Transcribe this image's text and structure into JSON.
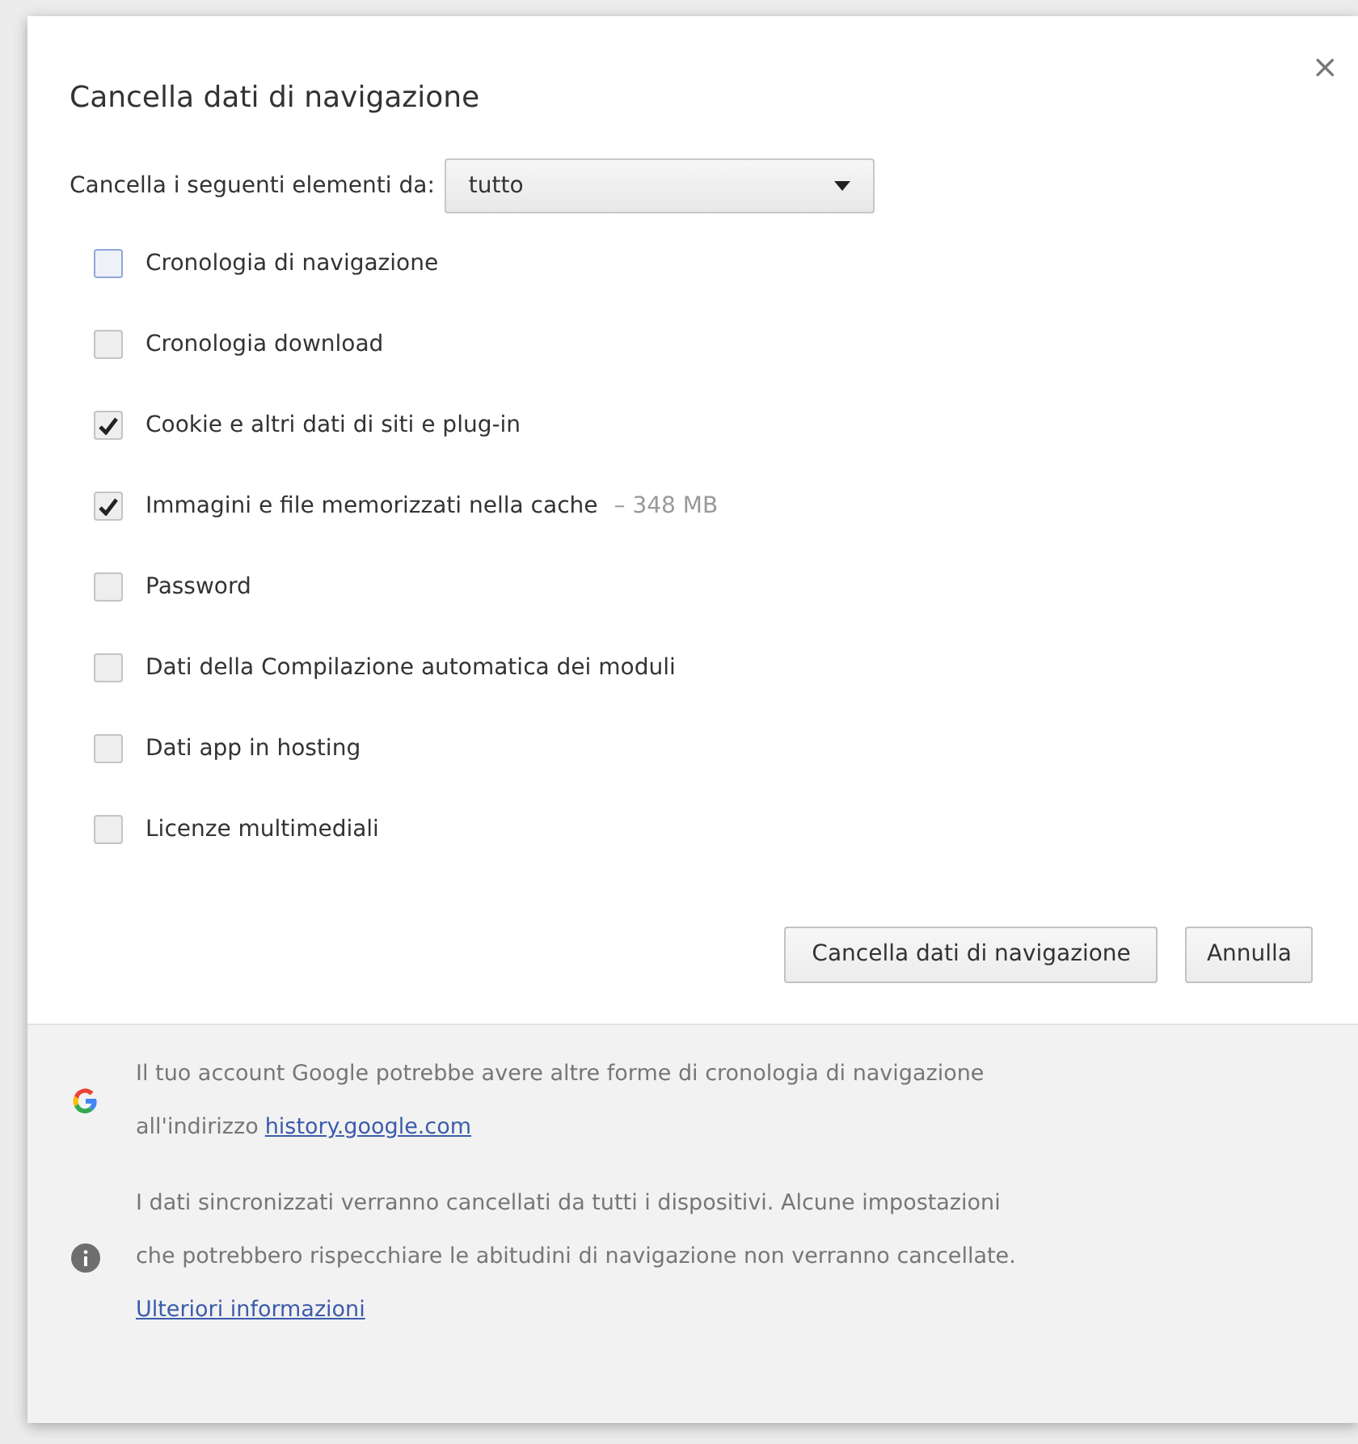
{
  "dialog": {
    "title": "Cancella dati di navigazione",
    "close": "×"
  },
  "range": {
    "label": "Cancella i seguenti elementi da:",
    "value": "tutto"
  },
  "items": [
    {
      "label": "Cronologia di navigazione",
      "checked": false,
      "focused": true
    },
    {
      "label": "Cronologia download",
      "checked": false,
      "focused": false
    },
    {
      "label": "Cookie e altri dati di siti e plug-in",
      "checked": true,
      "focused": false
    },
    {
      "label": "Immagini e file memorizzati nella cache",
      "checked": true,
      "focused": false,
      "detail": "–  348 MB"
    },
    {
      "label": "Password",
      "checked": false,
      "focused": false
    },
    {
      "label": "Dati della Compilazione automatica dei moduli",
      "checked": false,
      "focused": false
    },
    {
      "label": "Dati app in hosting",
      "checked": false,
      "focused": false
    },
    {
      "label": "Licenze multimediali",
      "checked": false,
      "focused": false
    }
  ],
  "buttons": [
    "Cancella dati di navigazione",
    "Annulla"
  ],
  "notes": [
    {
      "kind": "google",
      "lines": [
        "Il tuo account Google potrebbe avere altre forme di cronologia di navigazione"
      ],
      "prefix": "all'indirizzo",
      "link": "history.google.com"
    },
    {
      "kind": "info",
      "lines": [
        "I dati sincronizzati verranno cancellati da tutti i dispositivi. Alcune impostazioni",
        "che potrebbero rispecchiare le abitudini di navigazione non verranno cancellate."
      ],
      "link": "Ulteriori informazioni"
    }
  ]
}
